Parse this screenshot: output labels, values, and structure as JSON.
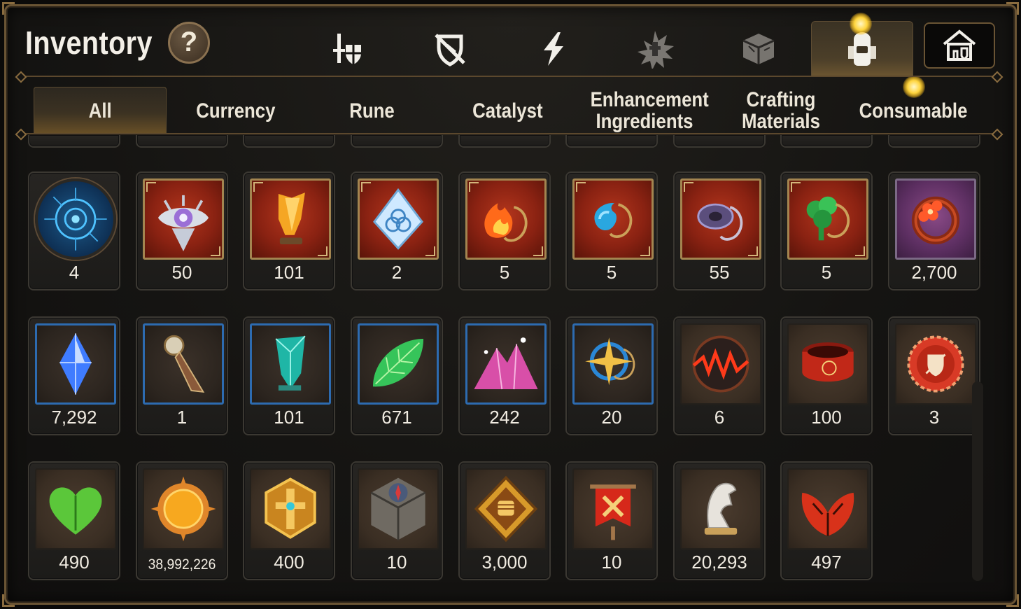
{
  "header": {
    "title": "Inventory",
    "help_label": "?"
  },
  "top_icons": [
    {
      "name": "equipment-icon",
      "active": false
    },
    {
      "name": "shield-off-icon",
      "active": false
    },
    {
      "name": "lightning-icon",
      "active": false
    },
    {
      "name": "burst-icon",
      "active": false
    },
    {
      "name": "cube-icon",
      "active": false
    },
    {
      "name": "backpack-icon",
      "active": true
    },
    {
      "name": "house-icon",
      "active": false
    }
  ],
  "tabs": [
    {
      "label": "All",
      "active": true
    },
    {
      "label": "Currency",
      "active": false
    },
    {
      "label": "Rune",
      "active": false
    },
    {
      "label": "Catalyst",
      "active": false
    },
    {
      "label": "Enhancement Ingredients",
      "active": false
    },
    {
      "label": "Crafting Materials",
      "active": false
    },
    {
      "label": "Consumable",
      "active": false
    }
  ],
  "rows": [
    [
      {
        "item": "blue-orb-icon",
        "count": "4"
      },
      {
        "item": "eye-crest-icon",
        "count": "50"
      },
      {
        "item": "amber-crystal-icon",
        "count": "101"
      },
      {
        "item": "triquetra-diamond-icon",
        "count": "2"
      },
      {
        "item": "flame-pendant-icon",
        "count": "5"
      },
      {
        "item": "water-pendant-icon",
        "count": "5"
      },
      {
        "item": "ring-pendant-icon",
        "count": "55"
      },
      {
        "item": "clover-pendant-icon",
        "count": "5"
      },
      {
        "item": "flower-ring-icon",
        "count": "2,700"
      }
    ],
    [
      {
        "item": "blue-gem-icon",
        "count": "7,292"
      },
      {
        "item": "dagger-charm-icon",
        "count": "1"
      },
      {
        "item": "teal-crystal-icon",
        "count": "101"
      },
      {
        "item": "green-leaf-icon",
        "count": "671"
      },
      {
        "item": "pink-mountain-icon",
        "count": "242"
      },
      {
        "item": "star-pendant-icon",
        "count": "20"
      },
      {
        "item": "lava-orb-icon",
        "count": "6"
      },
      {
        "item": "red-band-icon",
        "count": "100"
      },
      {
        "item": "crest-badge-icon",
        "count": "3"
      }
    ],
    [
      {
        "item": "green-heart-icon",
        "count": "490"
      },
      {
        "item": "gold-coin-icon",
        "count": "38,992,226"
      },
      {
        "item": "gold-emblem-icon",
        "count": "400"
      },
      {
        "item": "stone-block-icon",
        "count": "10"
      },
      {
        "item": "fist-badge-icon",
        "count": "3,000"
      },
      {
        "item": "war-banner-icon",
        "count": "10"
      },
      {
        "item": "knight-piece-icon",
        "count": "20,293"
      },
      {
        "item": "red-leaf-icon",
        "count": "497"
      }
    ]
  ],
  "colors": {
    "frame_gold": "#6a5434",
    "accent_glow": "#ffd53d",
    "rarity_red": "#8a2212",
    "rarity_blue_border": "#2d6bb0"
  }
}
